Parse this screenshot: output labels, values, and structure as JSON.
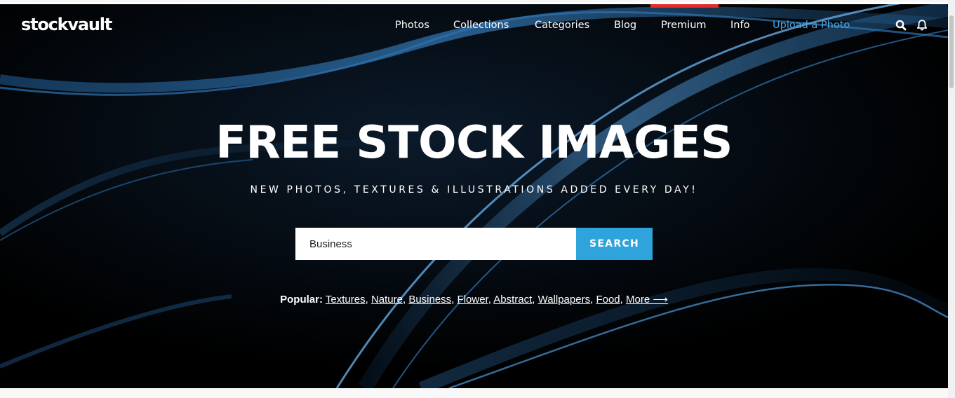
{
  "header": {
    "logo": "stockvault",
    "nav": {
      "photos": "Photos",
      "collections": "Collections",
      "categories": "Categories",
      "blog": "Blog",
      "premium": "Premium",
      "info": "Info",
      "upload": "Upload a Photo"
    },
    "icons": [
      "search-icon",
      "bell-icon"
    ]
  },
  "hero": {
    "title": "FREE STOCK IMAGES",
    "subtitle": "NEW PHOTOS, TEXTURES & ILLUSTRATIONS ADDED EVERY DAY!",
    "search": {
      "value": "Business",
      "button_label": "SEARCH"
    },
    "popular": {
      "label": "Popular:",
      "links": [
        "Textures",
        "Nature",
        "Business",
        "Flower",
        "Abstract",
        "Wallpapers",
        "Food",
        "More ⟶"
      ]
    }
  },
  "colors": {
    "accent_blue": "#2ea3dc",
    "upload_link": "#4ea3e0",
    "premium_bar": "#e52a2a",
    "hero_background": "#000000"
  }
}
